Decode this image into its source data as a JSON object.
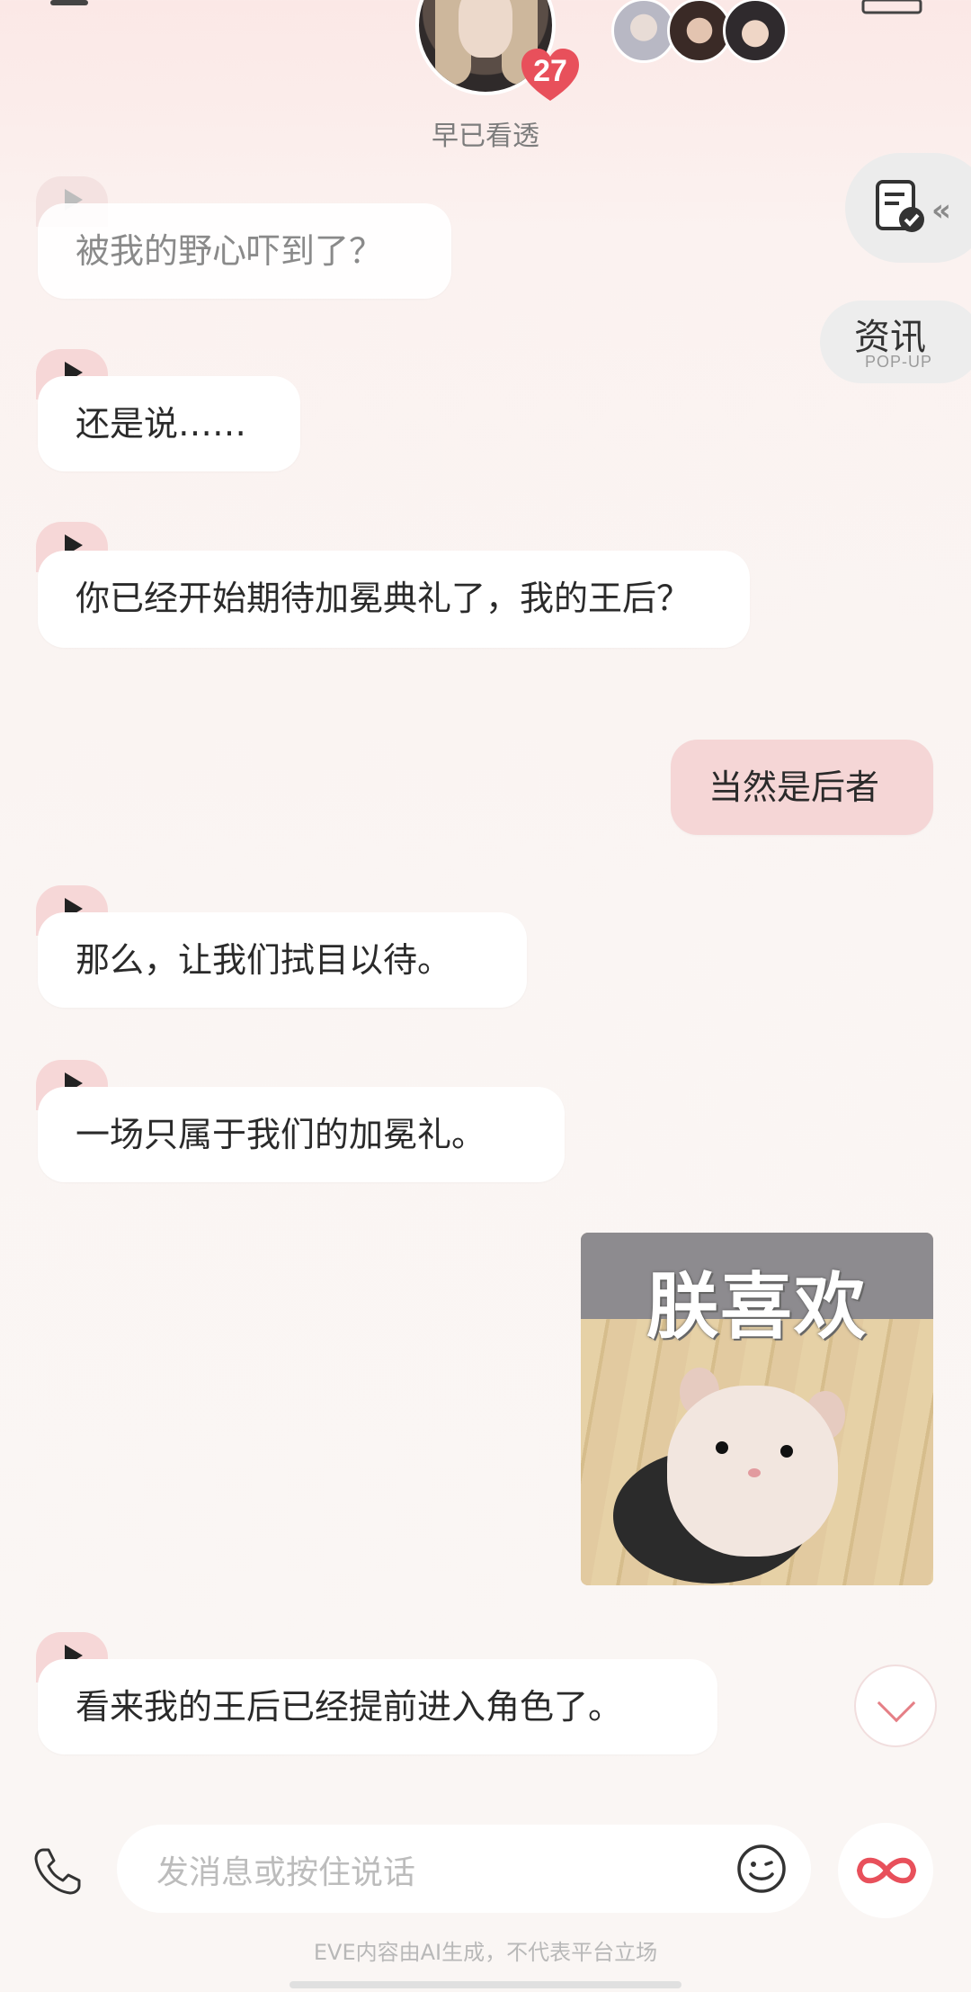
{
  "header": {
    "character_name": "早已看透",
    "affection_level": "27"
  },
  "side": {
    "news_title": "资讯",
    "news_subtitle": "POP-UP"
  },
  "messages": [
    {
      "from": "character",
      "text": "被我的野心吓到了？"
    },
    {
      "from": "character",
      "text": "还是说……"
    },
    {
      "from": "character",
      "text": "你已经开始期待加冕典礼了，我的王后？"
    },
    {
      "from": "user",
      "text": "当然是后者"
    },
    {
      "from": "character",
      "text": "那么，让我们拭目以待。"
    },
    {
      "from": "character",
      "text": "一场只属于我们的加冕礼。"
    },
    {
      "from": "user",
      "type": "sticker",
      "text": "朕喜欢"
    },
    {
      "from": "character",
      "text": "看来我的王后已经提前进入角色了。"
    }
  ],
  "input": {
    "placeholder": "发消息或按住说话"
  },
  "footer": {
    "disclaimer": "EVE内容由AI生成，不代表平台立场"
  },
  "colors": {
    "accent": "#e8505b",
    "user_bubble": "#f5d6d6",
    "play_tab": "#f6d7d7"
  }
}
